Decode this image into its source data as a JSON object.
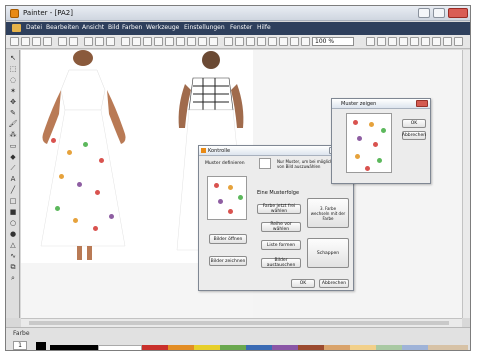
{
  "window": {
    "title": "Painter - [PA2]"
  },
  "menu": [
    "Datei",
    "Bearbeiten",
    "Ansicht",
    "Bild",
    "Farben",
    "Werkzeuge",
    "Einstellungen",
    "Fenster",
    "Hilfe"
  ],
  "toolbar": {
    "zoom_value": "100 %"
  },
  "bottom": {
    "label": "Farbe",
    "size_value": "1",
    "palette": [
      "#000000",
      "#ffffff",
      "#c9302c",
      "#e38d24",
      "#e7cf2a",
      "#6aa84f",
      "#3b6bb4",
      "#8a56a6",
      "#9b4a2f",
      "#d9a36b",
      "#f2d08a",
      "#a9c9a3",
      "#9fb3d8"
    ]
  },
  "dialog_main": {
    "title": "Kontrolle",
    "label_muster": "Muster definieren",
    "hint": "Nur Muster, um bei mögliche Farbe von Bild auszuwählen",
    "group_title": "Eine Musterfolge",
    "btn_select_color": "Farbe jetzt frei wählen",
    "btn_alternate": "Reihe vor wählen",
    "btn_flip": "Liste formen",
    "btn_swap": "Bilder austauschen",
    "btn_change_color": "3. Farbe wechseln mit der Farbe",
    "btn_split": "Schappen",
    "btn_save": "Bilder öffnen",
    "btn_draw": "Bilder zeichnen",
    "btn_ok": "OK",
    "btn_cancel": "Abbrechen"
  },
  "dialog_small": {
    "title": "Muster zeigen",
    "btn_ok": "OK",
    "btn_cancel": "Abbrechen"
  }
}
